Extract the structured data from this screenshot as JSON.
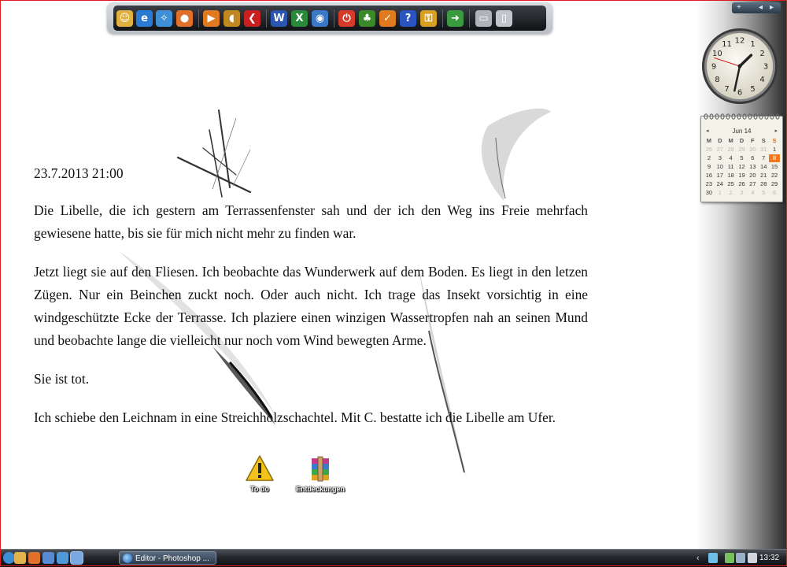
{
  "quick_launch": {
    "items": [
      {
        "name": "user-folder-icon",
        "glyph": "☺",
        "color": "#e0b040"
      },
      {
        "name": "internet-explorer-icon",
        "glyph": "e",
        "color": "#2a7bd4"
      },
      {
        "name": "safari-icon",
        "glyph": "✧",
        "color": "#3f8fd6"
      },
      {
        "name": "firefox-icon",
        "glyph": "●",
        "color": "#e0702a"
      },
      {
        "name": "media-player-icon",
        "glyph": "▶",
        "color": "#e07a20"
      },
      {
        "name": "speaker-icon",
        "glyph": "◖",
        "color": "#c08820"
      },
      {
        "name": "red-arrow-icon",
        "glyph": "❮",
        "color": "#c82020"
      },
      {
        "name": "word-icon",
        "glyph": "W",
        "color": "#2a55b0"
      },
      {
        "name": "excel-icon",
        "glyph": "X",
        "color": "#2a8a3c"
      },
      {
        "name": "camera-icon",
        "glyph": "◉",
        "color": "#3a78c8"
      },
      {
        "name": "power-icon",
        "glyph": "⏻",
        "color": "#d83a2a"
      },
      {
        "name": "tree-icon",
        "glyph": "♣",
        "color": "#3a8a2a"
      },
      {
        "name": "checkmark-icon",
        "glyph": "✓",
        "color": "#e07a20"
      },
      {
        "name": "help-icon",
        "glyph": "?",
        "color": "#2a55c0"
      },
      {
        "name": "key-icon",
        "glyph": "⚿",
        "color": "#d8a020"
      },
      {
        "name": "sync-arrow-icon",
        "glyph": "➜",
        "color": "#3a9a40"
      },
      {
        "name": "projector-icon",
        "glyph": "▭",
        "color": "#b0b4ba"
      },
      {
        "name": "recycle-bin-icon",
        "glyph": "▯",
        "color": "#c0c6cc"
      }
    ]
  },
  "document": {
    "date": "23.7.2013 21:00",
    "paragraphs": [
      "Die Libelle, die ich gestern am Terrassenfenster sah und der ich den Weg ins Freie mehrfach gewiesene hatte, bis sie für mich nicht mehr zu finden war.",
      "Jetzt liegt sie auf den Fliesen. Ich beobachte das Wunderwerk auf dem Boden. Es liegt in den letzen Zügen. Nur ein Beinchen zuckt noch. Oder auch nicht. Ich trage das Insekt vorsichtig in eine windgeschützte Ecke der Terrasse. Ich plaziere einen winzigen Wassertropfen nah an seinen Mund und beobachte lange die vielleicht nur noch vom Wind bewegten Arme.",
      "Sie ist tot.",
      "Ich schiebe den Leichnam in eine Streichholzschachtel. Mit C. bestatte ich die Libelle am Ufer."
    ]
  },
  "desktop_icons": {
    "todo": {
      "label": "To do"
    },
    "entdeckungen": {
      "label": "Entdeckungen"
    }
  },
  "sidebar": {
    "add_label": "+",
    "prev_label": "◂",
    "next_label": "▸"
  },
  "clock": {
    "numerals": [
      "12",
      "1",
      "2",
      "3",
      "4",
      "5",
      "6",
      "7",
      "8",
      "9",
      "10",
      "11"
    ],
    "hour": 13,
    "minute": 32
  },
  "calendar": {
    "month_label": "Jun 14",
    "prev": "◂",
    "next": "▸",
    "weekdays": [
      "M",
      "D",
      "M",
      "D",
      "F",
      "S",
      "S"
    ],
    "days": [
      {
        "d": "26",
        "other": true
      },
      {
        "d": "27",
        "other": true
      },
      {
        "d": "28",
        "other": true
      },
      {
        "d": "29",
        "other": true
      },
      {
        "d": "30",
        "other": true
      },
      {
        "d": "31",
        "other": true
      },
      {
        "d": "1"
      },
      {
        "d": "2"
      },
      {
        "d": "3"
      },
      {
        "d": "4"
      },
      {
        "d": "5"
      },
      {
        "d": "6"
      },
      {
        "d": "7"
      },
      {
        "d": "8",
        "today": true
      },
      {
        "d": "9"
      },
      {
        "d": "10"
      },
      {
        "d": "11"
      },
      {
        "d": "12"
      },
      {
        "d": "13"
      },
      {
        "d": "14"
      },
      {
        "d": "15"
      },
      {
        "d": "16"
      },
      {
        "d": "17"
      },
      {
        "d": "18"
      },
      {
        "d": "19"
      },
      {
        "d": "20"
      },
      {
        "d": "21"
      },
      {
        "d": "22"
      },
      {
        "d": "23"
      },
      {
        "d": "24"
      },
      {
        "d": "25"
      },
      {
        "d": "26"
      },
      {
        "d": "27"
      },
      {
        "d": "28"
      },
      {
        "d": "29"
      },
      {
        "d": "30"
      },
      {
        "d": "1",
        "other": true
      },
      {
        "d": "2",
        "other": true
      },
      {
        "d": "3",
        "other": true
      },
      {
        "d": "4",
        "other": true
      },
      {
        "d": "5",
        "other": true
      },
      {
        "d": "6",
        "other": true
      }
    ]
  },
  "taskbar": {
    "quick_launch": [
      {
        "name": "start-orb-icon",
        "color": "#3c8fd8"
      },
      {
        "name": "explorer-icon",
        "color": "#e2b34a"
      },
      {
        "name": "firefox-taskbar-icon",
        "color": "#e0702a"
      },
      {
        "name": "window-icon",
        "color": "#5a8ad0"
      },
      {
        "name": "globe-icon",
        "color": "#4f9ad6"
      },
      {
        "name": "app-active-icon",
        "color": "#7aa8e0"
      }
    ],
    "task_label": "Editor - Photoshop ...",
    "tray_chevron": "‹",
    "tray_icons": [
      {
        "name": "network-tray-icon",
        "color": "#6fc0e8"
      },
      {
        "name": "battery-tray-icon",
        "color": "#7ac060"
      },
      {
        "name": "monitor-tray-icon",
        "color": "#9ab0c8"
      },
      {
        "name": "volume-tray-icon",
        "color": "#d0d6dc"
      }
    ],
    "time": "13:32"
  }
}
